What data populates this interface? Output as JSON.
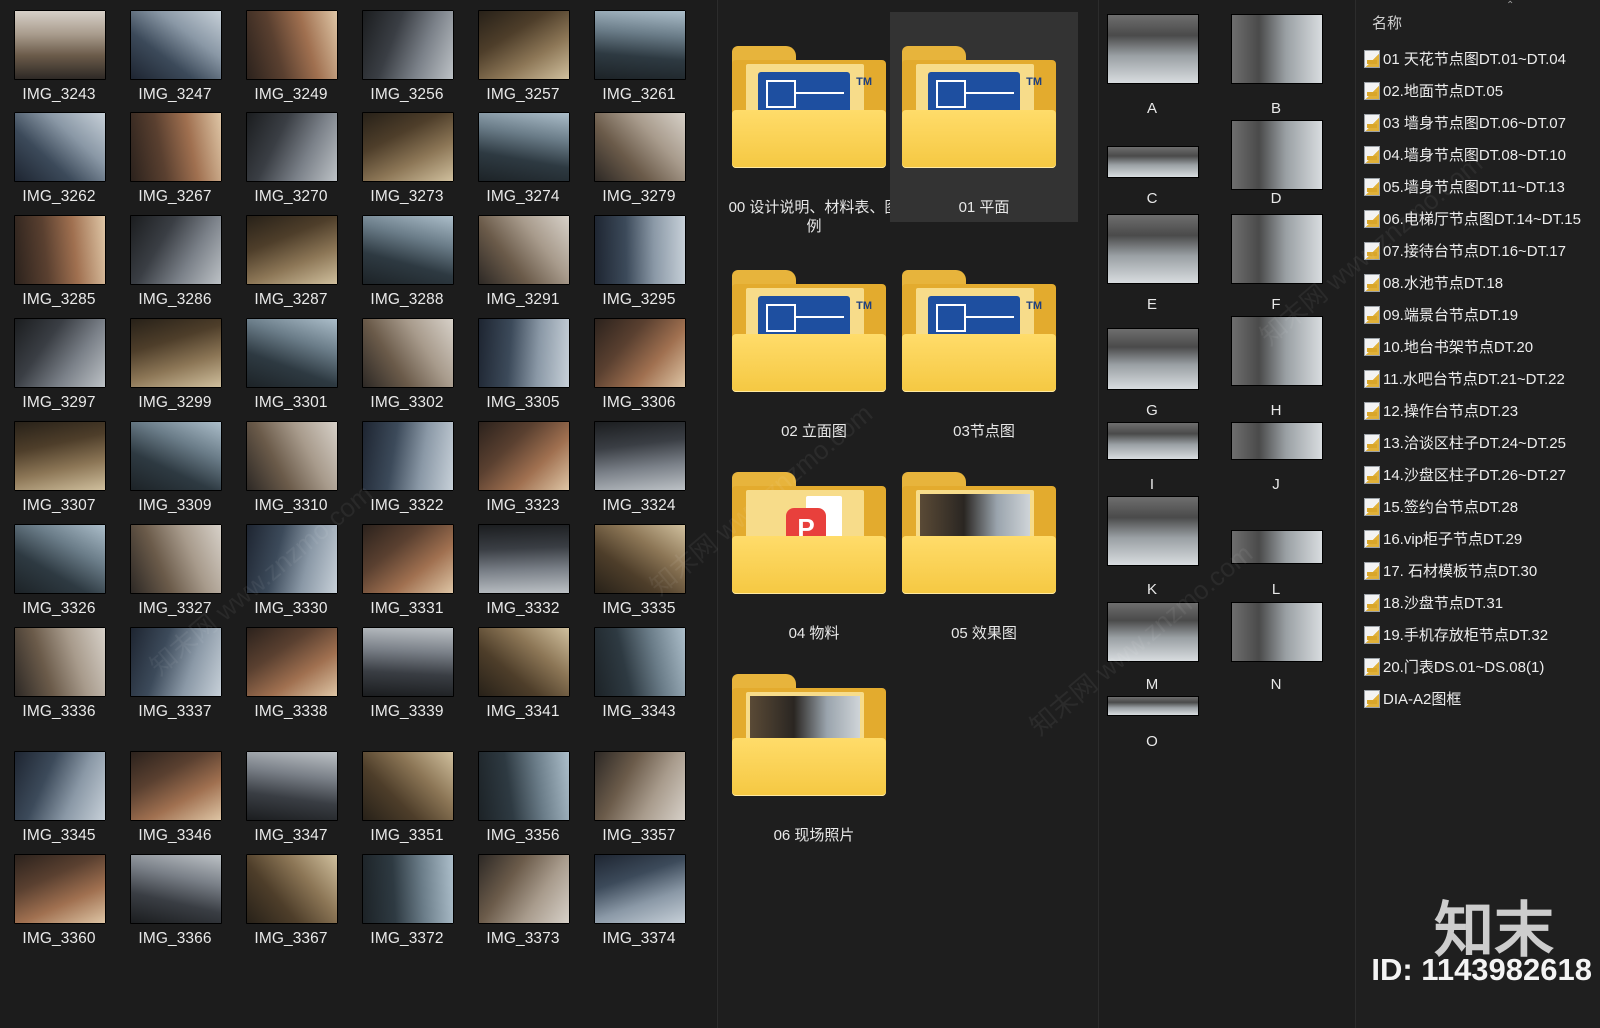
{
  "photos": [
    "IMG_3243",
    "IMG_3247",
    "IMG_3249",
    "IMG_3256",
    "IMG_3257",
    "IMG_3261",
    "IMG_3262",
    "IMG_3267",
    "IMG_3270",
    "IMG_3273",
    "IMG_3274",
    "IMG_3279",
    "IMG_3285",
    "IMG_3286",
    "IMG_3287",
    "IMG_3288",
    "IMG_3291",
    "IMG_3295",
    "IMG_3297",
    "IMG_3299",
    "IMG_3301",
    "IMG_3302",
    "IMG_3305",
    "IMG_3306",
    "IMG_3307",
    "IMG_3309",
    "IMG_3310",
    "IMG_3322",
    "IMG_3323",
    "IMG_3324",
    "IMG_3326",
    "IMG_3327",
    "IMG_3330",
    "IMG_3331",
    "IMG_3332",
    "IMG_3335",
    "IMG_3336",
    "IMG_3337",
    "IMG_3338",
    "IMG_3339",
    "IMG_3341",
    "IMG_3343",
    "IMG_3345",
    "IMG_3346",
    "IMG_3347",
    "IMG_3351",
    "IMG_3356",
    "IMG_3357",
    "IMG_3360",
    "IMG_3366",
    "IMG_3367",
    "IMG_3372",
    "IMG_3373",
    "IMG_3374"
  ],
  "folders": [
    {
      "label": "00  设计说明、材料表、图例",
      "kind": "cad",
      "selected": false
    },
    {
      "label": "01 平面",
      "kind": "cad",
      "selected": true
    },
    {
      "label": "02 立面图",
      "kind": "cad",
      "selected": false
    },
    {
      "label": "03节点图",
      "kind": "cad",
      "selected": false
    },
    {
      "label": "04 物料",
      "kind": "pdf",
      "selected": false
    },
    {
      "label": "05 效果图",
      "kind": "photo",
      "selected": false
    },
    {
      "label": "06 现场照片",
      "kind": "photo",
      "selected": false
    }
  ],
  "renders": [
    "A",
    "B",
    "C",
    "D",
    "E",
    "F",
    "G",
    "H",
    "I",
    "J",
    "K",
    "L",
    "M",
    "N",
    "O"
  ],
  "list": {
    "header": "名称",
    "items": [
      "01 天花节点图DT.01~DT.04",
      "02.地面节点DT.05",
      "03 墙身节点图DT.06~DT.07",
      "04.墙身节点图DT.08~DT.10",
      "05.墙身节点图DT.11~DT.13",
      "06.电梯厅节点图DT.14~DT.15",
      "07.接待台节点DT.16~DT.17",
      "08.水池节点DT.18",
      "09.端景台节点DT.19",
      "10.地台书架节点DT.20",
      "11.水吧台节点DT.21~DT.22",
      "12.操作台节点DT.23",
      "13.洽谈区柱子DT.24~DT.25",
      "14.沙盘区柱子DT.26~DT.27",
      "15.签约台节点DT.28",
      "16.vip柜子节点DT.29",
      "17. 石材模板节点DT.30",
      "18.沙盘节点DT.31",
      "19.手机存放柜节点DT.32",
      "20.门表DS.01~DS.08(1)",
      "DIA-A2图框"
    ]
  },
  "watermark": {
    "logo": "知末",
    "id": "ID: 1143982618",
    "diag": "知末网 www.znzmo.com"
  },
  "colors": {
    "folder": "#f5c842",
    "selected": "#333333",
    "bg": "#1b1b1b"
  }
}
